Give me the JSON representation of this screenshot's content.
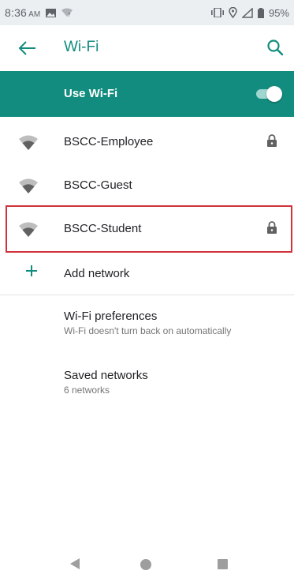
{
  "status_bar": {
    "time": "8:36",
    "ampm": "AM",
    "battery": "95%"
  },
  "app_bar": {
    "title": "Wi-Fi"
  },
  "use_wifi": {
    "label": "Use Wi-Fi",
    "enabled": true
  },
  "networks": [
    {
      "name": "BSCC-Employee",
      "secured": true
    },
    {
      "name": "BSCC-Guest",
      "secured": false
    },
    {
      "name": "BSCC-Student",
      "secured": true
    }
  ],
  "add_network": {
    "label": "Add network"
  },
  "preferences": {
    "title": "Wi-Fi preferences",
    "subtitle": "Wi-Fi doesn't turn back on automatically"
  },
  "saved_networks": {
    "title": "Saved networks",
    "subtitle": "6 networks"
  },
  "colors": {
    "accent": "#128c7e",
    "highlight": "#d0313a"
  },
  "icons": {
    "back": "arrow-left-icon",
    "search": "search-icon",
    "wifi": "wifi-signal-icon",
    "lock": "lock-icon",
    "add": "plus-icon"
  }
}
